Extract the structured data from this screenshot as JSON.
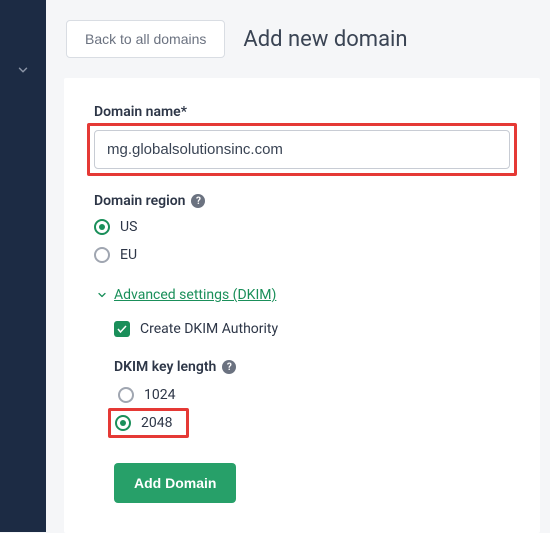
{
  "header": {
    "back_label": "Back to all domains",
    "title": "Add new domain"
  },
  "form": {
    "domain_label": "Domain name*",
    "domain_value": "mg.globalsolutionsinc.com",
    "region_label": "Domain region",
    "region_options": {
      "us": "US",
      "eu": "EU"
    },
    "advanced_label": "Advanced settings (DKIM)",
    "create_dkim_label": "Create DKIM Authority",
    "key_length_label": "DKIM key length",
    "key_options": {
      "k1024": "1024",
      "k2048": "2048"
    },
    "submit_label": "Add Domain"
  }
}
